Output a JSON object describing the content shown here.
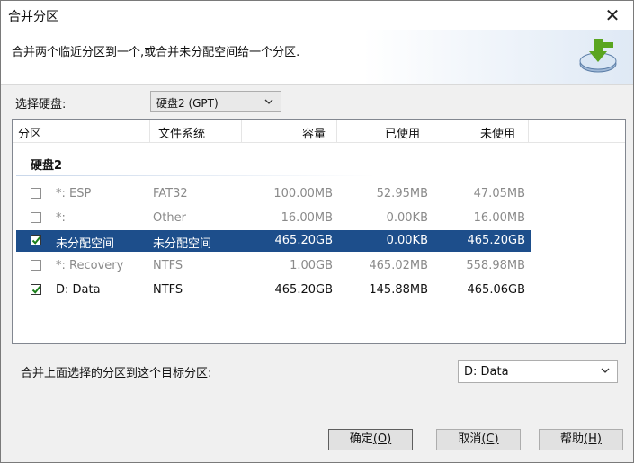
{
  "window": {
    "title": "合并分区"
  },
  "banner": {
    "description": "合并两个临近分区到一个,或合并未分配空间给一个分区."
  },
  "disk_select": {
    "label": "选择硬盘:",
    "value": "硬盘2 (GPT)"
  },
  "table": {
    "headers": [
      "分区",
      "文件系统",
      "容量",
      "已使用",
      "未使用"
    ],
    "group": "硬盘2",
    "rows": [
      {
        "name": "*: ESP",
        "fs": "FAT32",
        "capacity": "100.00MB",
        "used": "52.95MB",
        "unused": "47.05MB",
        "checked": false,
        "enabled": false,
        "selected": false
      },
      {
        "name": "*:",
        "fs": "Other",
        "capacity": "16.00MB",
        "used": "0.00KB",
        "unused": "16.00MB",
        "checked": false,
        "enabled": false,
        "selected": false
      },
      {
        "name": "未分配空间",
        "fs": "未分配空间",
        "capacity": "465.20GB",
        "used": "0.00KB",
        "unused": "465.20GB",
        "checked": true,
        "enabled": true,
        "selected": true
      },
      {
        "name": "*: Recovery",
        "fs": "NTFS",
        "capacity": "1.00GB",
        "used": "465.02MB",
        "unused": "558.98MB",
        "checked": false,
        "enabled": false,
        "selected": false
      },
      {
        "name": "D: Data",
        "fs": "NTFS",
        "capacity": "465.20GB",
        "used": "145.88MB",
        "unused": "465.06GB",
        "checked": true,
        "enabled": true,
        "selected": false
      }
    ]
  },
  "target": {
    "label": "合并上面选择的分区到这个目标分区:",
    "value": "D: Data"
  },
  "buttons": {
    "ok": {
      "label": "确定",
      "accel": "(O)"
    },
    "cancel": {
      "label": "取消",
      "accel": "(C)"
    },
    "help": {
      "label": "帮助",
      "accel": "(H)"
    }
  },
  "colors": {
    "selection": "#1d4e8b",
    "disabled_text": "#8a8a8a",
    "icon_green": "#5aa51f"
  }
}
